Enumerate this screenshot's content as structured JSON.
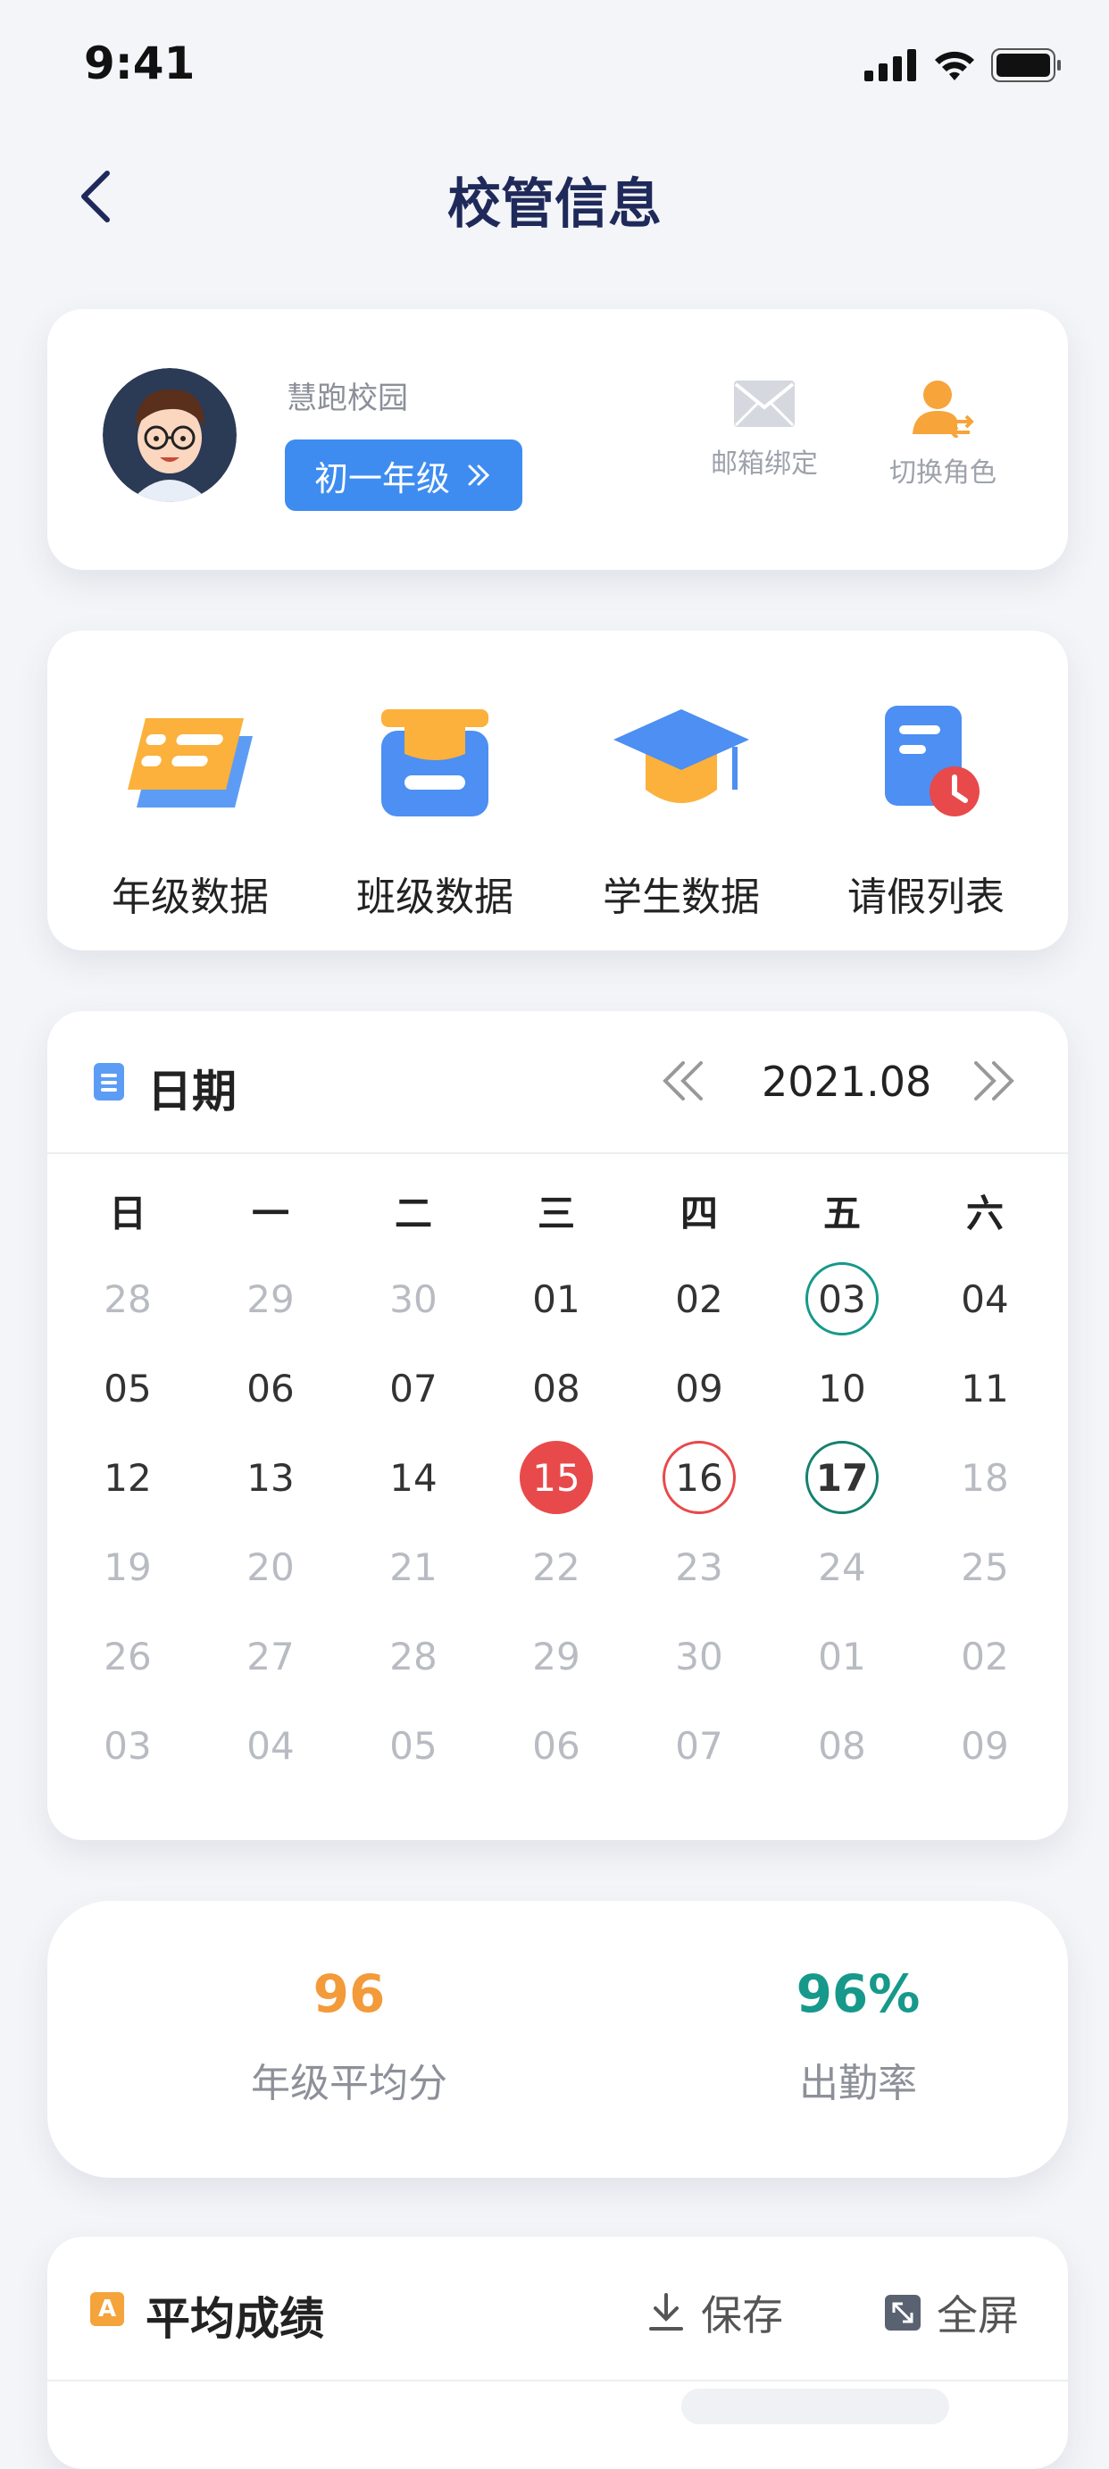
{
  "status": {
    "time": "9:41"
  },
  "nav": {
    "title": "校管信息"
  },
  "profile": {
    "school": "慧跑校园",
    "grade_button": "初一年级",
    "email_label": "邮箱绑定",
    "switch_label": "切换角色"
  },
  "features": [
    {
      "label": "年级数据"
    },
    {
      "label": "班级数据"
    },
    {
      "label": "学生数据"
    },
    {
      "label": "请假列表"
    }
  ],
  "calendar": {
    "title": "日期",
    "month": "2021.08",
    "weekdays": [
      "日",
      "一",
      "二",
      "三",
      "四",
      "五",
      "六"
    ],
    "weeks": [
      [
        "28",
        "29",
        "30",
        "01",
        "02",
        "03",
        "04"
      ],
      [
        "05",
        "06",
        "07",
        "08",
        "09",
        "10",
        "11"
      ],
      [
        "12",
        "13",
        "14",
        "15",
        "16",
        "17",
        "18"
      ],
      [
        "19",
        "20",
        "21",
        "22",
        "23",
        "24",
        "25"
      ],
      [
        "26",
        "27",
        "28",
        "29",
        "30",
        "01",
        "02"
      ],
      [
        "03",
        "04",
        "05",
        "06",
        "07",
        "08",
        "09"
      ]
    ]
  },
  "stats": {
    "avg_score": "96",
    "avg_score_label": "年级平均分",
    "attendance": "96%",
    "attendance_label": "出勤率"
  },
  "average": {
    "title": "平均成绩",
    "icon_text": "A",
    "save_label": "保存",
    "fullscreen_label": "全屏"
  },
  "colors": {
    "accent_blue": "#3f8cf0",
    "orange": "#f39a3a",
    "teal": "#16998a",
    "red": "#e8494a"
  }
}
